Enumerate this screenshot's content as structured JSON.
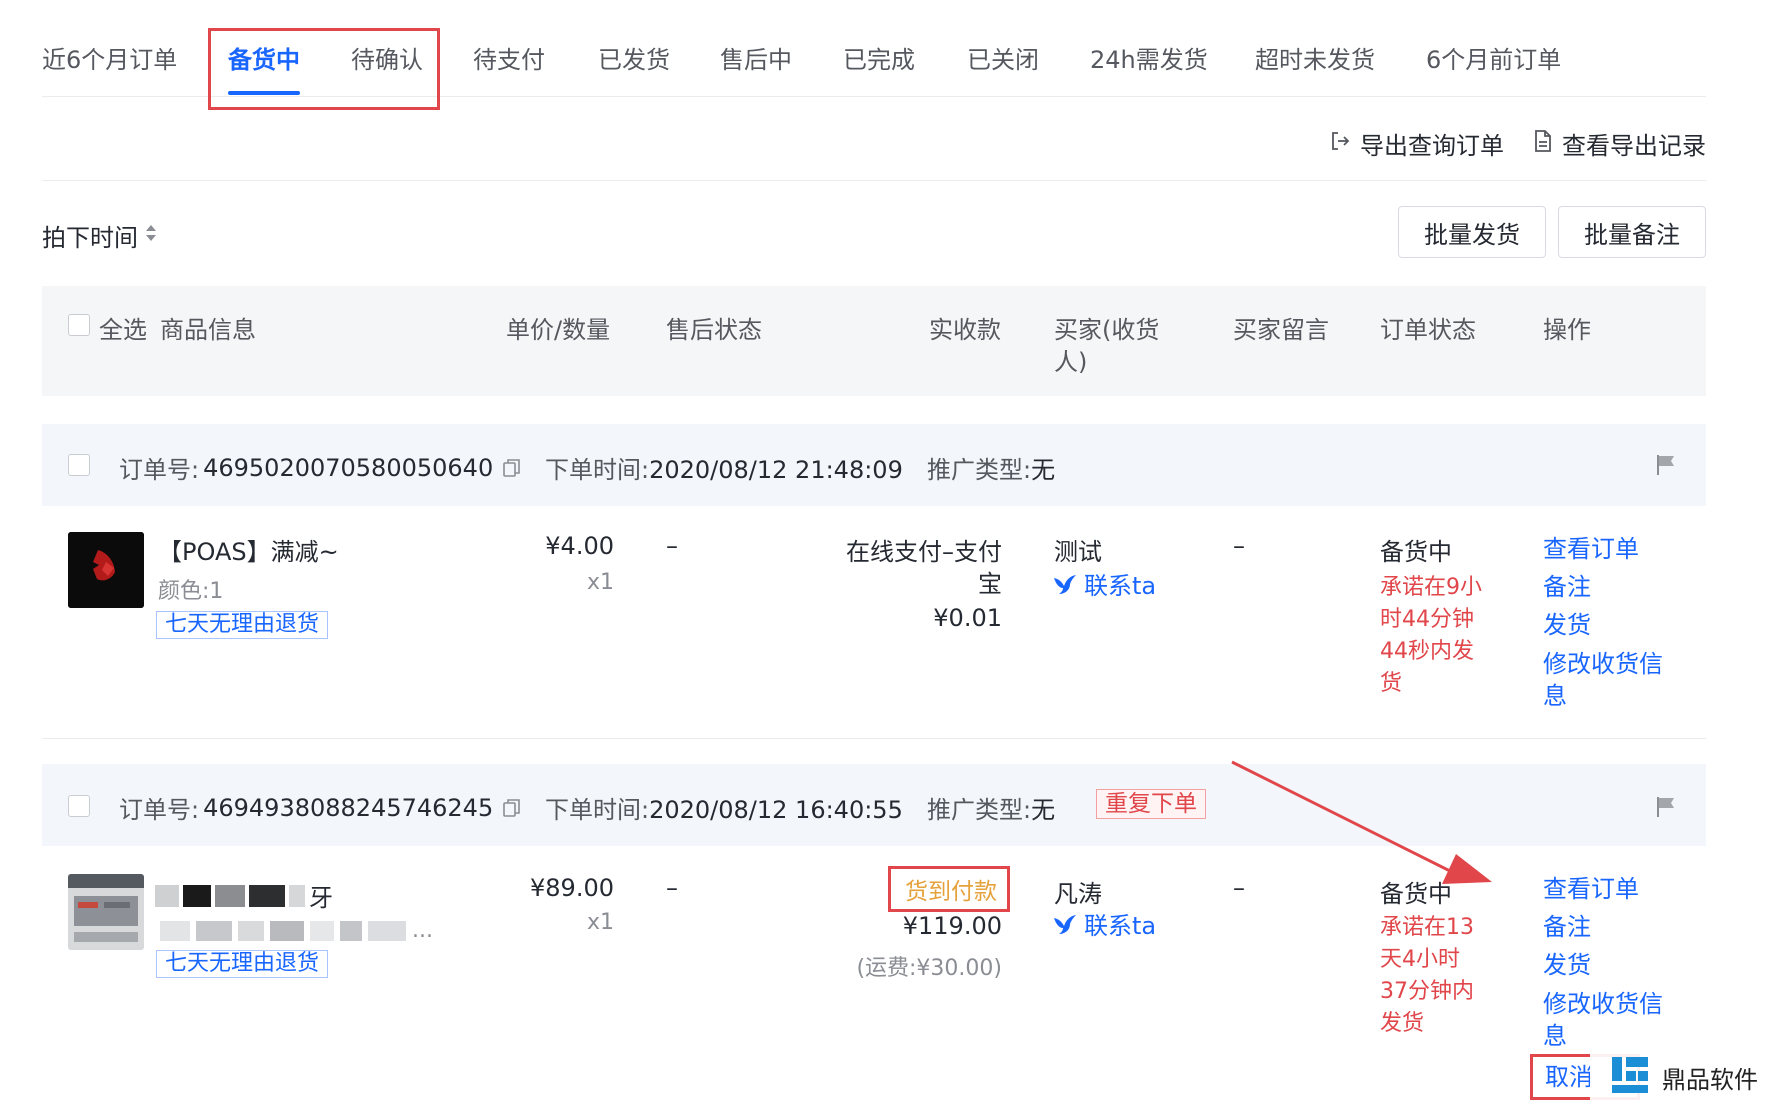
{
  "tabs": [
    {
      "label": "近6个月订单",
      "active": false
    },
    {
      "label": "备货中",
      "active": true
    },
    {
      "label": "待确认",
      "active": false
    },
    {
      "label": "待支付",
      "active": false
    },
    {
      "label": "已发货",
      "active": false
    },
    {
      "label": "售后中",
      "active": false
    },
    {
      "label": "已完成",
      "active": false
    },
    {
      "label": "已关闭",
      "active": false
    },
    {
      "label": "24h需发货",
      "active": false
    },
    {
      "label": "超时未发货",
      "active": false
    },
    {
      "label": "6个月前订单",
      "active": false
    }
  ],
  "actions": {
    "export_orders": "导出查询订单",
    "view_export_records": "查看导出记录"
  },
  "toolbar": {
    "sort_label": "拍下时间",
    "batch_ship": "批量发货",
    "batch_note": "批量备注"
  },
  "table_header": {
    "select_all": "全选",
    "product_info": "商品信息",
    "price_qty": "单价/数量",
    "after_sale": "售后状态",
    "received": "实收款",
    "buyer_line1": "买家(收货",
    "buyer_line2": "人)",
    "buyer_message": "买家留言",
    "order_status": "订单状态",
    "operation": "操作"
  },
  "orders": [
    {
      "order_no_label": "订单号:",
      "order_no": "4695020070580050640",
      "time_label": "下单时间:",
      "time": "2020/08/12 21:48:09",
      "promo_label": "推广类型:",
      "promo": "无",
      "badge": "",
      "product_title": "【POAS】满减~",
      "product_sku": "颜色:1",
      "product_tag": "七天无理由退货",
      "price": "¥4.00",
      "qty": "x1",
      "after_sale": "–",
      "payment_line1": "在线支付–支付",
      "payment_line2": "宝",
      "amount": "¥0.01",
      "freight": "",
      "buyer": "测试",
      "contact": "联系ta",
      "message": "–",
      "status": "备货中",
      "promise": [
        "承诺在9小",
        "时44分钟",
        "44秒内发",
        "货"
      ],
      "ops": [
        "查看订单",
        "备注",
        "发货",
        "修改收货信",
        "息"
      ]
    },
    {
      "order_no_label": "订单号:",
      "order_no": "4694938088245746245",
      "time_label": "下单时间:",
      "time": "2020/08/12 16:40:55",
      "promo_label": "推广类型:",
      "promo": "无",
      "badge": "重复下单",
      "product_title": "牙",
      "product_sku": "...",
      "product_tag": "七天无理由退货",
      "price": "¥89.00",
      "qty": "x1",
      "after_sale": "–",
      "payment_line1": "货到付款",
      "payment_line2": "",
      "amount": "¥119.00",
      "freight": "(运费:¥30.00)",
      "buyer": "凡涛",
      "contact": "联系ta",
      "message": "–",
      "status": "备货中",
      "promise": [
        "承诺在13",
        "天4小时",
        "37分钟内",
        "发货"
      ],
      "ops": [
        "查看订单",
        "备注",
        "发货",
        "修改收货信",
        "息",
        "取消"
      ]
    }
  ],
  "watermark": {
    "brand": "鼎品软件"
  },
  "colors": {
    "accent": "#1966ff",
    "danger": "#e0464a",
    "warning": "#e5a23c",
    "text": "#252931",
    "muted": "#55585f"
  }
}
